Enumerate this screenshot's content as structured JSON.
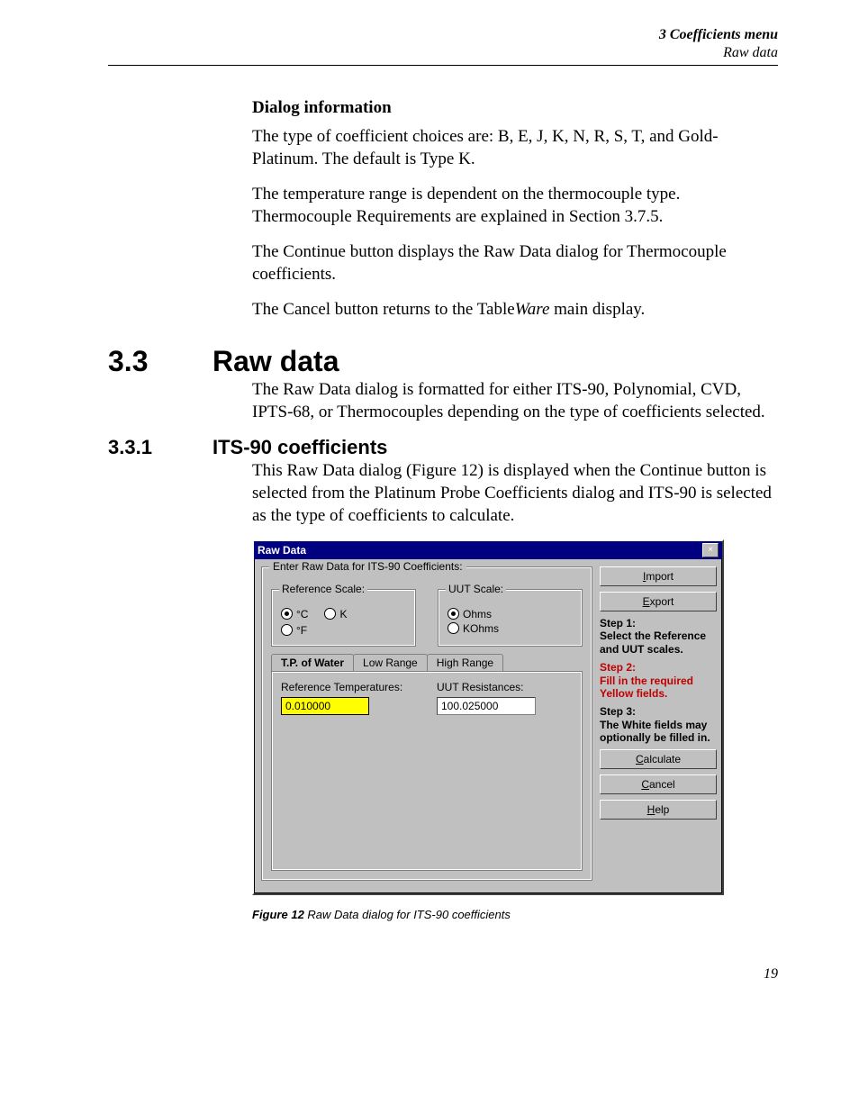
{
  "runhead": {
    "a": "3  Coefficients menu",
    "b": "Raw data"
  },
  "body": {
    "h_dialog_info": "Dialog information",
    "p1": "The type of coefficient choices are: B, E, J, K, N, R, S, T, and Gold-Platinum. The default is Type K.",
    "p2": "The temperature range is dependent on the thermocouple type. Thermocouple Requirements are explained in Section 3.7.5.",
    "p3": "The Continue button displays the Raw Data dialog for Thermocouple coefficients.",
    "p4a": "The Cancel button returns to the Table",
    "p4b": "Ware",
    "p4c": " main display."
  },
  "sec33": {
    "num": "3.3",
    "title": "Raw data",
    "p": "The Raw Data dialog is formatted for either ITS-90, Polynomial, CVD, IPTS-68, or Thermocouples depending on the type of coefficients selected."
  },
  "sec331": {
    "num": "3.3.1",
    "title": "ITS-90 coefficients",
    "p": "This Raw Data dialog (Figure 12) is displayed when the Continue button is selected from the Platinum Probe Coefficients dialog and ITS-90 is selected as the type of coefficients to calculate."
  },
  "dialog": {
    "title": "Raw Data",
    "close_glyph": "×",
    "group_legend": "Enter Raw Data for ITS-90 Coefficients:",
    "ref_scale": {
      "legend": "Reference Scale:",
      "c": "°C",
      "k": "K",
      "f": "°F",
      "selected": "c"
    },
    "uut_scale": {
      "legend": "UUT Scale:",
      "ohms": "Ohms",
      "kohms": "KOhms",
      "selected": "ohms"
    },
    "tabs": {
      "tp": "T.P. of Water",
      "low": "Low Range",
      "high": "High Range"
    },
    "panel": {
      "ref_label": "Reference Temperatures:",
      "ref_value": "0.010000",
      "uut_label": "UUT Resistances:",
      "uut_value": "100.025000"
    },
    "side": {
      "import_pre": "I",
      "import_rest": "mport",
      "export_pre": "E",
      "export_rest": "xport",
      "step1a": "Step 1:",
      "step1b": "Select the Reference and UUT scales.",
      "step2a": "Step 2:",
      "step2b": "Fill in the required Yellow fields.",
      "step3a": "Step 3:",
      "step3b": "The White fields may optionally be filled in.",
      "calc_pre": "C",
      "calc_rest": "alculate",
      "cancel_pre": "C",
      "cancel_rest": "ancel",
      "help_pre": "H",
      "help_rest": "elp"
    }
  },
  "figure": {
    "label": "Figure 12",
    "caption": "   Raw Data dialog for ITS-90 coefficients"
  },
  "pagenum": "19"
}
